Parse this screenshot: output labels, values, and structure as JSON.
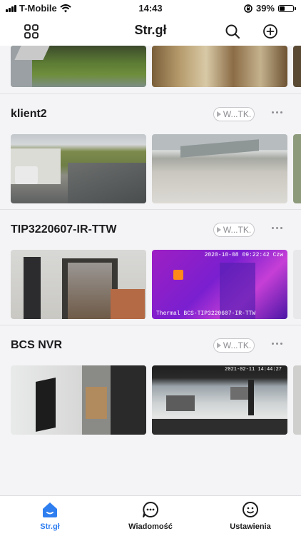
{
  "status_bar": {
    "carrier": "T-Mobile",
    "time": "14:43",
    "battery": "39%",
    "battery_level": 0.39
  },
  "header": {
    "title": "Str.gł"
  },
  "groups": [
    {
      "name": "klient2",
      "pill": "W...TK.",
      "cameras": [
        {
          "overlay": ""
        },
        {
          "overlay": ""
        }
      ]
    },
    {
      "name": "TIP3220607-IR-TTW",
      "pill": "W...TK.",
      "cameras": [
        {
          "overlay": ""
        },
        {
          "overlay": "Thermal BCS-TIP3220607-IR-TTW",
          "timestamp": "2020-10-08 09:22:42 Czw"
        }
      ]
    },
    {
      "name": "BCS NVR",
      "pill": "W...TK.",
      "cameras": [
        {
          "overlay": ""
        },
        {
          "overlay": "",
          "timestamp": "2021-02-11 14:44:27"
        }
      ]
    }
  ],
  "tab_bar": {
    "items": [
      {
        "label": "Str.gł",
        "active": true
      },
      {
        "label": "Wiadomość",
        "active": false
      },
      {
        "label": "Ustawienia",
        "active": false
      }
    ]
  },
  "colors": {
    "accent": "#2f7ef0",
    "thermal": "#9e1fc3"
  }
}
